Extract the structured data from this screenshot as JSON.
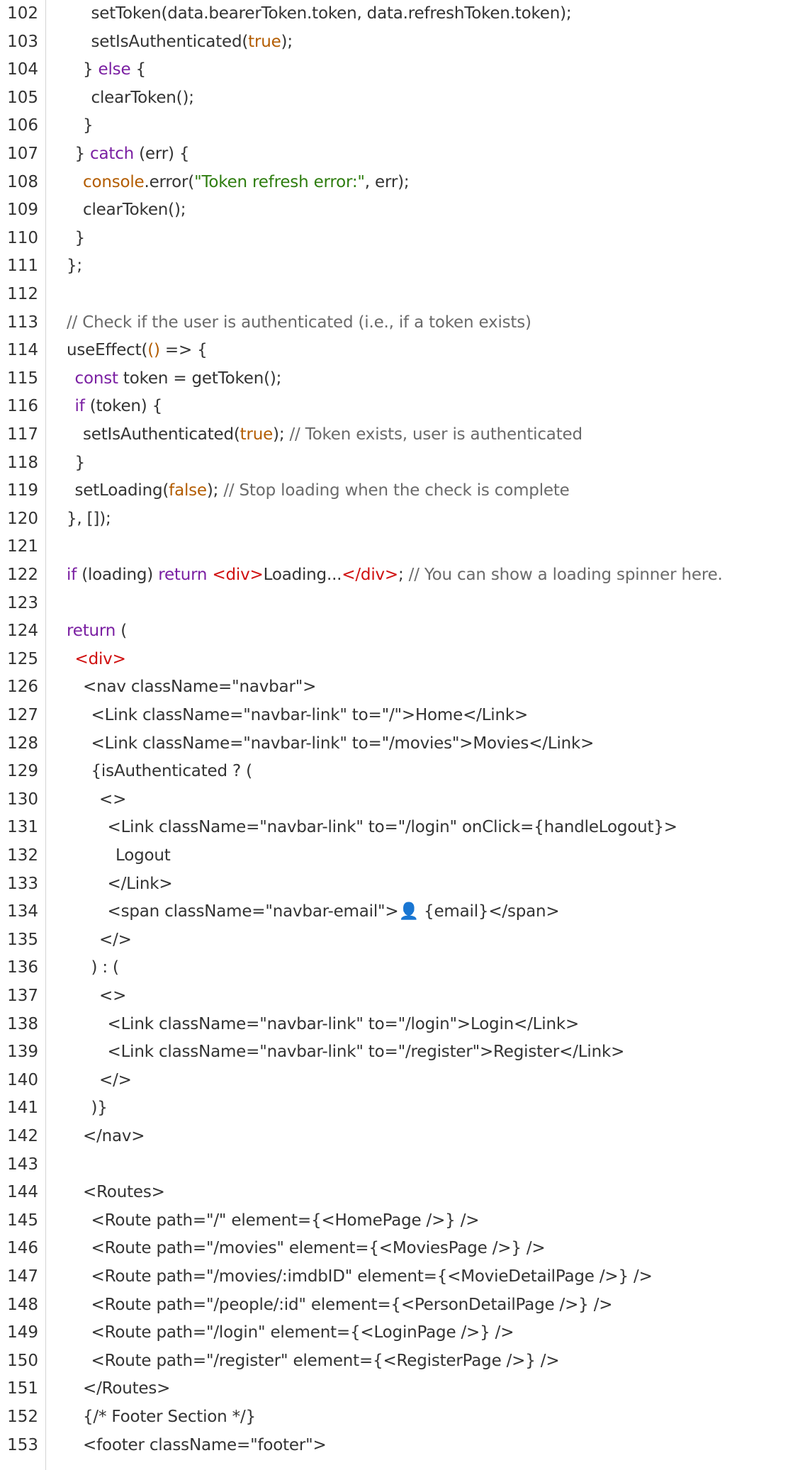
{
  "colors": {
    "default": "#333333",
    "keyword": "#7a1fa2",
    "boolean": "#b35c00",
    "string": "#2e7d0f",
    "comment": "#6a6a6a",
    "tag": "#d01010",
    "icon": "#1e88e5"
  },
  "code_lines": [
    {
      "number": "102",
      "indent": 3,
      "tokens": [
        [
          "default",
          "setToken(data.bearerToken.token, data.refreshToken.token);"
        ]
      ]
    },
    {
      "number": "103",
      "indent": 3,
      "tokens": [
        [
          "default",
          "setIsAuthenticated("
        ],
        [
          "boolean",
          "true"
        ],
        [
          "default",
          ");"
        ]
      ]
    },
    {
      "number": "104",
      "indent": 2,
      "tokens": [
        [
          "default",
          "} "
        ],
        [
          "keyword",
          "else"
        ],
        [
          "default",
          " {"
        ]
      ]
    },
    {
      "number": "105",
      "indent": 3,
      "tokens": [
        [
          "default",
          "clearToken();"
        ]
      ]
    },
    {
      "number": "106",
      "indent": 2,
      "tokens": [
        [
          "default",
          "}"
        ]
      ]
    },
    {
      "number": "107",
      "indent": 1,
      "tokens": [
        [
          "default",
          "} "
        ],
        [
          "keyword",
          "catch"
        ],
        [
          "default",
          " (err) {"
        ]
      ]
    },
    {
      "number": "108",
      "indent": 2,
      "tokens": [
        [
          "object",
          "console"
        ],
        [
          "default",
          ".error("
        ],
        [
          "string",
          "\"Token refresh error:\""
        ],
        [
          "default",
          ", err);"
        ]
      ]
    },
    {
      "number": "109",
      "indent": 2,
      "tokens": [
        [
          "default",
          "clearToken();"
        ]
      ]
    },
    {
      "number": "110",
      "indent": 1,
      "tokens": [
        [
          "default",
          "}"
        ]
      ]
    },
    {
      "number": "111",
      "indent": 0,
      "tokens": [
        [
          "default",
          "};"
        ]
      ]
    },
    {
      "number": "112",
      "indent": 0,
      "tokens": []
    },
    {
      "number": "113",
      "indent": 0,
      "tokens": [
        [
          "comment",
          "// Check if the user is authenticated (i.e., if a token exists)"
        ]
      ]
    },
    {
      "number": "114",
      "indent": 0,
      "tokens": [
        [
          "default",
          "useEffect("
        ],
        [
          "boolean",
          "()"
        ],
        [
          "default",
          " => {"
        ]
      ]
    },
    {
      "number": "115",
      "indent": 1,
      "tokens": [
        [
          "keyword",
          "const"
        ],
        [
          "default",
          " token = getToken();"
        ]
      ]
    },
    {
      "number": "116",
      "indent": 1,
      "tokens": [
        [
          "keyword",
          "if"
        ],
        [
          "default",
          " (token) {"
        ]
      ]
    },
    {
      "number": "117",
      "indent": 2,
      "tokens": [
        [
          "default",
          "setIsAuthenticated("
        ],
        [
          "boolean",
          "true"
        ],
        [
          "default",
          "); "
        ],
        [
          "comment",
          "// Token exists, user is authenticated"
        ]
      ]
    },
    {
      "number": "118",
      "indent": 1,
      "tokens": [
        [
          "default",
          "}"
        ]
      ]
    },
    {
      "number": "119",
      "indent": 1,
      "tokens": [
        [
          "default",
          "setLoading("
        ],
        [
          "boolean",
          "false"
        ],
        [
          "default",
          "); "
        ],
        [
          "comment",
          "// Stop loading when the check is complete"
        ]
      ]
    },
    {
      "number": "120",
      "indent": 0,
      "tokens": [
        [
          "default",
          "}, []);"
        ]
      ]
    },
    {
      "number": "121",
      "indent": 0,
      "tokens": []
    },
    {
      "number": "122",
      "indent": 0,
      "tokens": [
        [
          "keyword",
          "if"
        ],
        [
          "default",
          " (loading) "
        ],
        [
          "keyword",
          "return"
        ],
        [
          "default",
          " "
        ],
        [
          "tag",
          "<div>"
        ],
        [
          "default",
          "Loading..."
        ],
        [
          "tag",
          "</div>"
        ],
        [
          "default",
          "; "
        ],
        [
          "comment",
          "// You can show a loading spinner here."
        ]
      ]
    },
    {
      "number": "123",
      "indent": 0,
      "tokens": []
    },
    {
      "number": "124",
      "indent": 0,
      "tokens": [
        [
          "keyword",
          "return"
        ],
        [
          "default",
          " ("
        ]
      ]
    },
    {
      "number": "125",
      "indent": 1,
      "tokens": [
        [
          "tag",
          "<div>"
        ]
      ]
    },
    {
      "number": "126",
      "indent": 2,
      "tokens": [
        [
          "default",
          "<nav className=\"navbar\">"
        ]
      ]
    },
    {
      "number": "127",
      "indent": 3,
      "tokens": [
        [
          "default",
          "<Link className=\"navbar-link\" to=\"/\">Home</Link>"
        ]
      ]
    },
    {
      "number": "128",
      "indent": 3,
      "tokens": [
        [
          "default",
          "<Link className=\"navbar-link\" to=\"/movies\">Movies</Link>"
        ]
      ]
    },
    {
      "number": "129",
      "indent": 3,
      "tokens": [
        [
          "default",
          "{isAuthenticated ? ("
        ]
      ]
    },
    {
      "number": "130",
      "indent": 4,
      "tokens": [
        [
          "default",
          "<>"
        ]
      ]
    },
    {
      "number": "131",
      "indent": 5,
      "tokens": [
        [
          "default",
          "<Link className=\"navbar-link\" to=\"/login\" onClick={handleLogout}>"
        ]
      ]
    },
    {
      "number": "132",
      "indent": 6,
      "tokens": [
        [
          "default",
          "Logout"
        ]
      ]
    },
    {
      "number": "133",
      "indent": 5,
      "tokens": [
        [
          "default",
          "</Link>"
        ]
      ]
    },
    {
      "number": "134",
      "indent": 5,
      "tokens": [
        [
          "default",
          "<span className=\"navbar-email\">"
        ],
        [
          "icon",
          "👤"
        ],
        [
          "default",
          " {email}</span>"
        ]
      ]
    },
    {
      "number": "135",
      "indent": 4,
      "tokens": [
        [
          "default",
          "</>"
        ]
      ]
    },
    {
      "number": "136",
      "indent": 3,
      "tokens": [
        [
          "default",
          ") : ("
        ]
      ]
    },
    {
      "number": "137",
      "indent": 4,
      "tokens": [
        [
          "default",
          "<>"
        ]
      ]
    },
    {
      "number": "138",
      "indent": 5,
      "tokens": [
        [
          "default",
          "<Link className=\"navbar-link\" to=\"/login\">Login</Link>"
        ]
      ]
    },
    {
      "number": "139",
      "indent": 5,
      "tokens": [
        [
          "default",
          "<Link className=\"navbar-link\" to=\"/register\">Register</Link>"
        ]
      ]
    },
    {
      "number": "140",
      "indent": 4,
      "tokens": [
        [
          "default",
          "</>"
        ]
      ]
    },
    {
      "number": "141",
      "indent": 3,
      "tokens": [
        [
          "default",
          ")}"
        ]
      ]
    },
    {
      "number": "142",
      "indent": 2,
      "tokens": [
        [
          "default",
          "</nav>"
        ]
      ]
    },
    {
      "number": "143",
      "indent": 0,
      "tokens": []
    },
    {
      "number": "144",
      "indent": 2,
      "tokens": [
        [
          "default",
          "<Routes>"
        ]
      ]
    },
    {
      "number": "145",
      "indent": 3,
      "tokens": [
        [
          "default",
          "<Route path=\"/\" element={<HomePage />} />"
        ]
      ]
    },
    {
      "number": "146",
      "indent": 3,
      "tokens": [
        [
          "default",
          "<Route path=\"/movies\" element={<MoviesPage />} />"
        ]
      ]
    },
    {
      "number": "147",
      "indent": 3,
      "tokens": [
        [
          "default",
          "<Route path=\"/movies/:imdbID\" element={<MovieDetailPage />} />"
        ]
      ]
    },
    {
      "number": "148",
      "indent": 3,
      "tokens": [
        [
          "default",
          "<Route path=\"/people/:id\" element={<PersonDetailPage />} />"
        ]
      ]
    },
    {
      "number": "149",
      "indent": 3,
      "tokens": [
        [
          "default",
          "<Route path=\"/login\" element={<LoginPage />} />"
        ]
      ]
    },
    {
      "number": "150",
      "indent": 3,
      "tokens": [
        [
          "default",
          "<Route path=\"/register\" element={<RegisterPage />} />"
        ]
      ]
    },
    {
      "number": "151",
      "indent": 2,
      "tokens": [
        [
          "default",
          "</Routes>"
        ]
      ]
    },
    {
      "number": "152",
      "indent": 2,
      "tokens": [
        [
          "default",
          "{/* Footer Section */}"
        ]
      ]
    },
    {
      "number": "153",
      "indent": 2,
      "tokens": [
        [
          "default",
          "<footer className=\"footer\">"
        ]
      ]
    }
  ]
}
